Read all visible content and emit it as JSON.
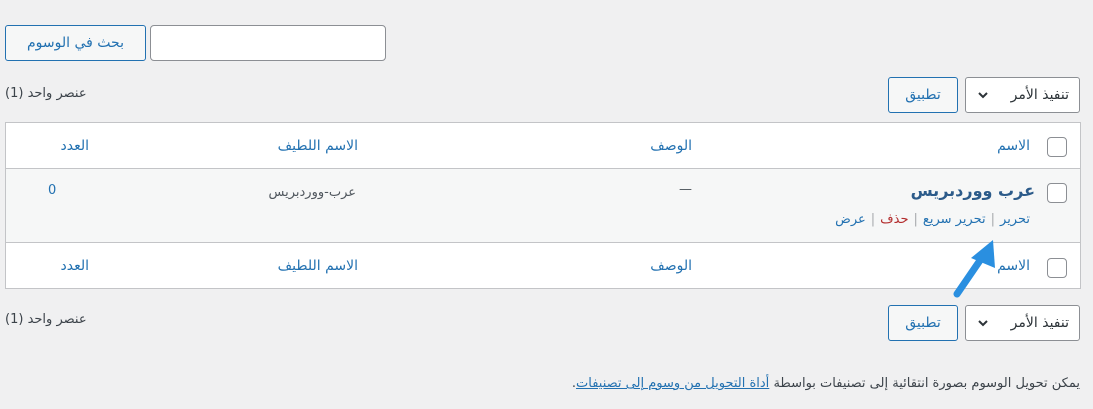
{
  "search": {
    "button_label": "بحث في الوسوم",
    "input_value": ""
  },
  "bulk_top": {
    "select_value": "تنفيذ الأمر",
    "apply_label": "تطبيق",
    "count": "عنصر واحد (1)"
  },
  "bulk_bottom": {
    "select_value": "تنفيذ الأمر",
    "apply_label": "تطبيق",
    "count": "عنصر واحد (1)"
  },
  "table": {
    "columns": {
      "name": "الاسم",
      "description": "الوصف",
      "slug": "الاسم اللطيف",
      "count": "العدد"
    },
    "rows": [
      {
        "name": "عرب ووردبريس",
        "description": "—",
        "slug": "عرب-ووردبريس",
        "count": "0",
        "actions": {
          "edit": "تحرير",
          "quick_edit": "تحرير سريع",
          "delete": "حذف",
          "view": "عرض"
        }
      }
    ]
  },
  "footer_note": {
    "text_before": "يمكن تحويل الوسوم بصورة انتقائية إلى تصنيفات بواسطة",
    "link": "أداة التحويل من وسوم إلى تصنيفات",
    "text_after": "."
  },
  "colors": {
    "accent": "#2271b1",
    "delete": "#b32d2e",
    "arrow": "#2a8fe0",
    "background": "#f0f0f1"
  },
  "icons": [
    "chevron-down-icon",
    "arrow-pointer-icon"
  ]
}
